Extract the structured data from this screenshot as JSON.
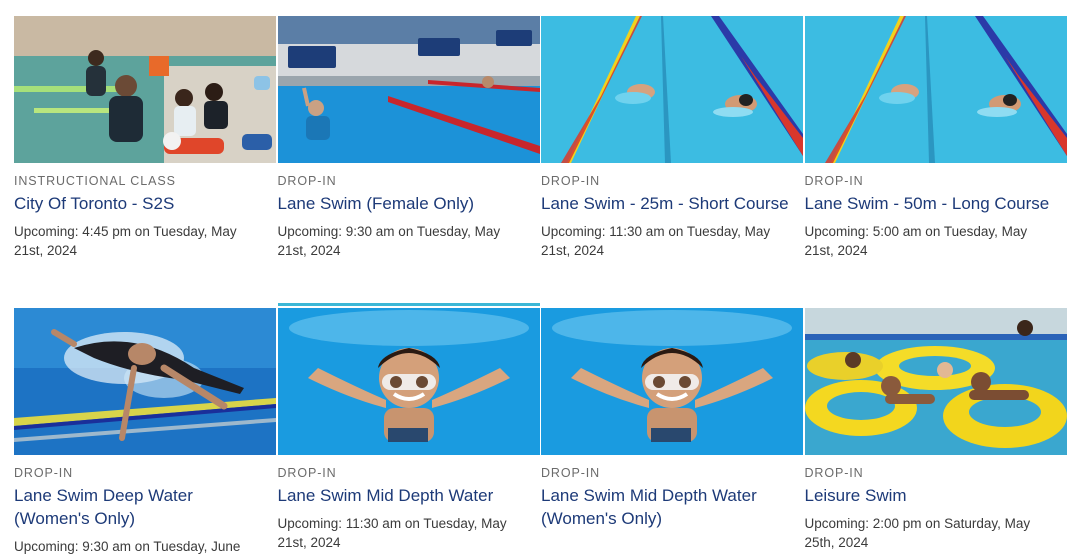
{
  "programs": [
    {
      "category": "INSTRUCTIONAL CLASS",
      "title": "City Of Toronto - S2S",
      "upcoming": "Upcoming: 4:45 pm on Tuesday, May 21st, 2024",
      "image": "swim-lesson-photo"
    },
    {
      "category": "DROP-IN",
      "title": "Lane Swim (Female Only)",
      "upcoming": "Upcoming: 9:30 am on Tuesday, May 21st, 2024",
      "image": "pool-lane-photo"
    },
    {
      "category": "DROP-IN",
      "title": "Lane Swim - 25m - Short Course",
      "upcoming": "Upcoming: 11:30 am on Tuesday, May 21st, 2024",
      "image": "lap-swimmers-photo"
    },
    {
      "category": "DROP-IN",
      "title": "Lane Swim - 50m - Long Course",
      "upcoming": "Upcoming: 5:00 am on Tuesday, May 21st, 2024",
      "image": "lap-swimmers-photo"
    },
    {
      "category": "DROP-IN",
      "title": "Lane Swim Deep Water (Women's Only)",
      "upcoming": "Upcoming: 9:30 am on Tuesday, June",
      "image": "freestyle-swimmer-photo"
    },
    {
      "category": "DROP-IN",
      "title": "Lane Swim Mid Depth Water",
      "upcoming": "Upcoming: 11:30 am on Tuesday, May 21st, 2024",
      "image": "underwater-swimmer-photo"
    },
    {
      "category": "DROP-IN",
      "title": "Lane Swim Mid Depth Water (Women's Only)",
      "upcoming": "",
      "image": "underwater-swimmer-photo"
    },
    {
      "category": "DROP-IN",
      "title": "Leisure Swim",
      "upcoming": "Upcoming: 2:00 pm on Saturday, May 25th, 2024",
      "image": "pool-float-rings-photo"
    }
  ],
  "colors": {
    "title": "#1d3a78",
    "category": "#6b6b6b",
    "body_text": "#3b3b3b",
    "active_indicator": "#3bb7d6"
  }
}
